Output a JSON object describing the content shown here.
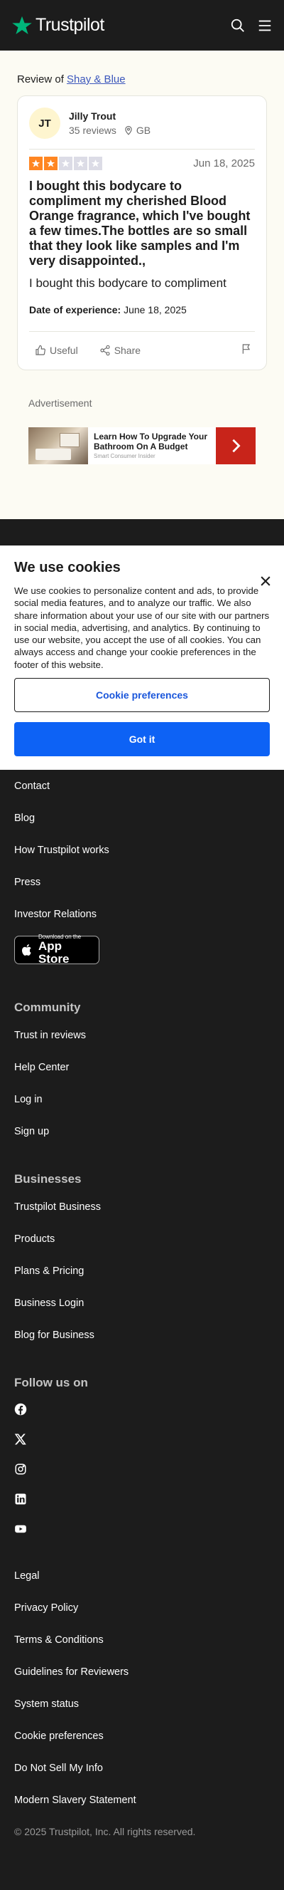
{
  "header": {
    "brand": "Trustpilot",
    "search_icon": "search-icon",
    "menu_icon": "menu-icon"
  },
  "review_of": {
    "prefix": "Review of",
    "company": "Shay & Blue"
  },
  "review": {
    "initials": "JT",
    "name": "Jilly Trout",
    "reviews_count": "35 reviews",
    "location": "GB",
    "rating": 2,
    "date": "Jun 18, 2025",
    "title": "I bought this bodycare to compliment my cherished Blood Orange fragrance, which I've bought a few times.The bottles are so small that they look like samples and I'm very disappointed.,",
    "body": "I bought this bodycare to compliment",
    "experience_label": "Date of experience:",
    "experience_date": "June 18, 2025",
    "useful_label": "Useful",
    "share_label": "Share"
  },
  "ad": {
    "label": "Advertisement",
    "title": "Learn How To Upgrade Your Bathroom On A Budget",
    "sponsor": "Smart Consumer Insider"
  },
  "cookie": {
    "title": "We use cookies",
    "text": "We use cookies to personalize content and ads, to provide social media features, and to analyze our traffic. We also share information about your use of our site with our partners in social media, advertising, and analytics. By continuing to use our website, you accept the use of all cookies. You can always access and change your cookie preferences in the footer of this website.",
    "pref_button": "Cookie preferences",
    "accept_button": "Got it"
  },
  "footer": {
    "about_links": [
      "Contact",
      "Blog",
      "How Trustpilot works",
      "Press",
      "Investor Relations"
    ],
    "appstore": {
      "small": "Download on the",
      "big": "App Store"
    },
    "community": {
      "title": "Community",
      "links": [
        "Trust in reviews",
        "Help Center",
        "Log in",
        "Sign up"
      ]
    },
    "businesses": {
      "title": "Businesses",
      "links": [
        "Trustpilot Business",
        "Products",
        "Plans & Pricing",
        "Business Login",
        "Blog for Business"
      ]
    },
    "follow": {
      "title": "Follow us on",
      "networks": [
        "facebook-icon",
        "x-icon",
        "instagram-icon",
        "linkedin-icon",
        "youtube-icon"
      ]
    },
    "legal_links": [
      "Legal",
      "Privacy Policy",
      "Terms & Conditions",
      "Guidelines for Reviewers",
      "System status",
      "Cookie preferences",
      "Do Not Sell My Info",
      "Modern Slavery Statement"
    ],
    "copyright": "© 2025 Trustpilot, Inc. All rights reserved."
  },
  "colors": {
    "star_on": "#ff8622",
    "star_off": "#dcdce6",
    "accept": "#0d62f5",
    "ad_button": "#c8241a",
    "brand_star": "#00b67a"
  }
}
